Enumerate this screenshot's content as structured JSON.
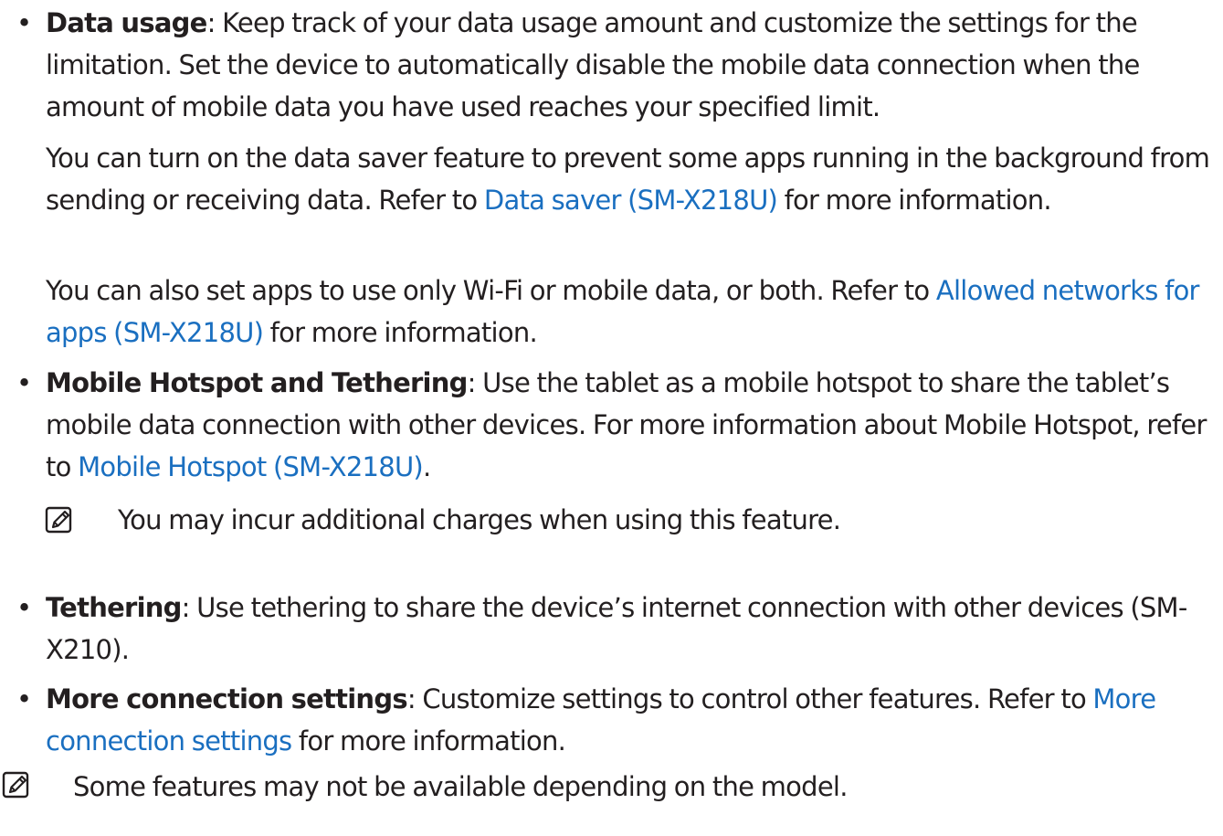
{
  "bullets": [
    {
      "term": "Data usage",
      "sep": ": ",
      "text": "Keep track of your data usage amount and customize the settings for the limitation. Set the device to automatically disable the mobile data connection when the amount of mobile data you have used reaches your specified limit."
    },
    {
      "term": "Mobile Hotspot and Tethering",
      "sep": ": ",
      "text_before": "Use the tablet as a mobile hotspot to share the tablet’s mobile data connection with other devices. For more information about Mobile Hotspot, refer to ",
      "link": "Mobile Hotspot (SM-X218U)",
      "text_after": "."
    },
    {
      "term": "Tethering",
      "sep": ": ",
      "text": "Use tethering to share the device’s internet connection with other devices (SM-X210)."
    },
    {
      "term": "More connection settings",
      "sep": ": ",
      "text_before": "Customize settings to control other features. Refer to ",
      "link": "More connection settings",
      "text_after": " for more information."
    }
  ],
  "data_usage_paras": [
    {
      "text_before": "You can turn on the data saver feature to prevent some apps running in the background from sending or receiving data. Refer to ",
      "link": "Data saver (SM-X218U)",
      "text_after": " for more information."
    },
    {
      "text_before": "You can also set apps to use only Wi-Fi or mobile data, or both. Refer to ",
      "link": "Allowed networks for apps (SM-X218U)",
      "text_after": " for more information."
    }
  ],
  "notes": [
    {
      "text": "You may incur additional charges when using this feature."
    },
    {
      "text": "Some features may not be available depending on the model."
    }
  ],
  "bullet_symbol": "•",
  "colors": {
    "text": "#231f20",
    "link": "#1a6fc0"
  },
  "icons": {
    "note": "note-pencil-icon"
  }
}
